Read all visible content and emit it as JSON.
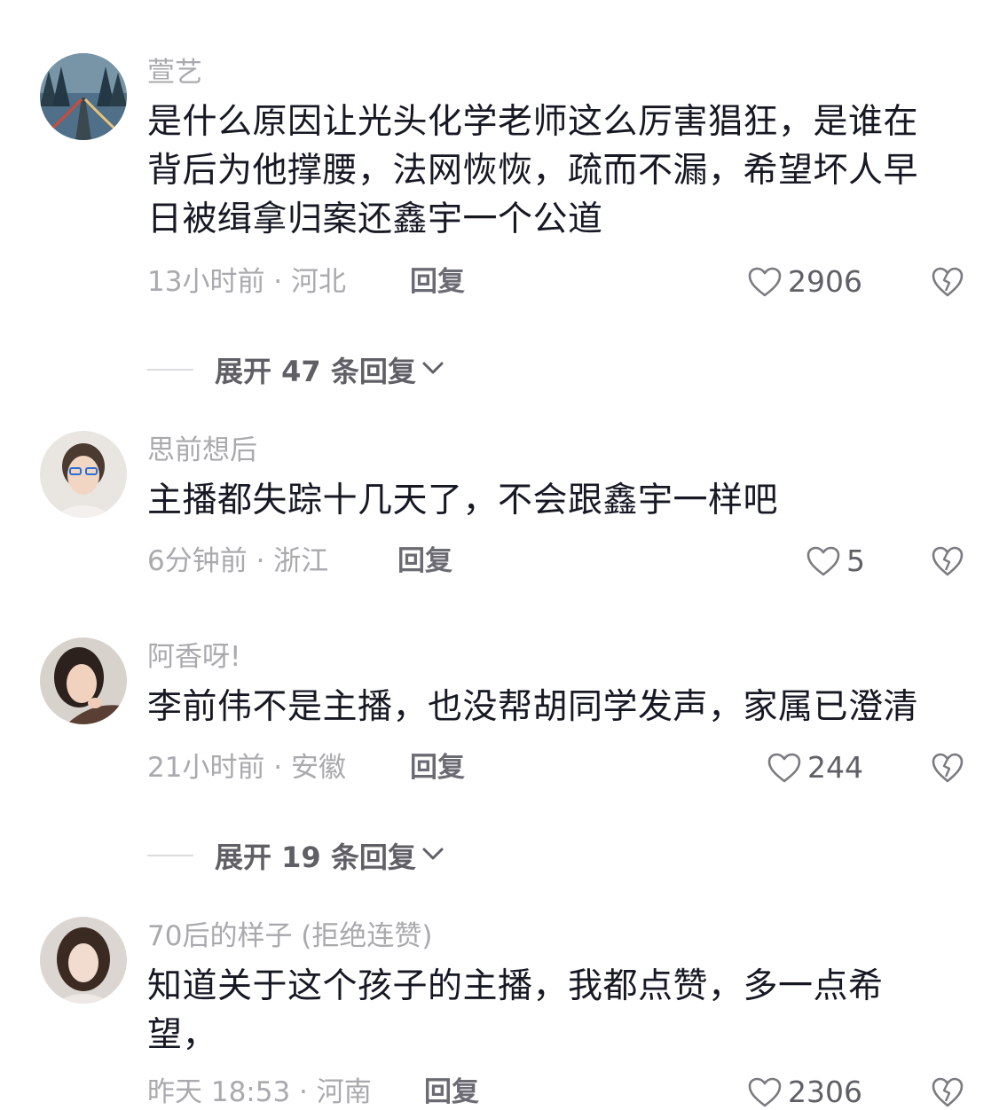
{
  "comments": [
    {
      "username": "萱艺",
      "lines": [
        "是什么原因让光头化学老师这么厉害猖狂，是谁在",
        "背后为他撑腰，法网恢恢，疏而不漏，希望坏人早",
        "日被缉拿归案还鑫宇一个公道"
      ],
      "meta": "13小时前 · 河北",
      "reply": "回复",
      "likes": "2906",
      "expand": "展开 47 条回复"
    },
    {
      "username": "思前想后",
      "lines": [
        "主播都失踪十几天了，不会跟鑫宇一样吧"
      ],
      "meta": "6分钟前 · 浙江",
      "reply": "回复",
      "likes": "5"
    },
    {
      "username": "阿香呀!",
      "lines": [
        "李前伟不是主播，也没帮胡同学发声，家属已澄清"
      ],
      "meta": "21小时前 · 安徽",
      "reply": "回复",
      "likes": "244",
      "expand": "展开 19 条回复"
    },
    {
      "username": "70后的样子 (拒绝连赞)",
      "lines": [
        "知道关于这个孩子的主播，我都点赞，多一点希",
        "望，"
      ],
      "meta": "昨天 18:53 · 河南",
      "reply": "回复",
      "likes": "2306"
    }
  ],
  "icons": {
    "like": "heart-outline-icon",
    "dislike": "broken-heart-icon",
    "expand": "chevron-down-icon"
  },
  "colors": {
    "text": "#161823",
    "muted": "#a9a9ae",
    "action": "#6b6b73"
  }
}
